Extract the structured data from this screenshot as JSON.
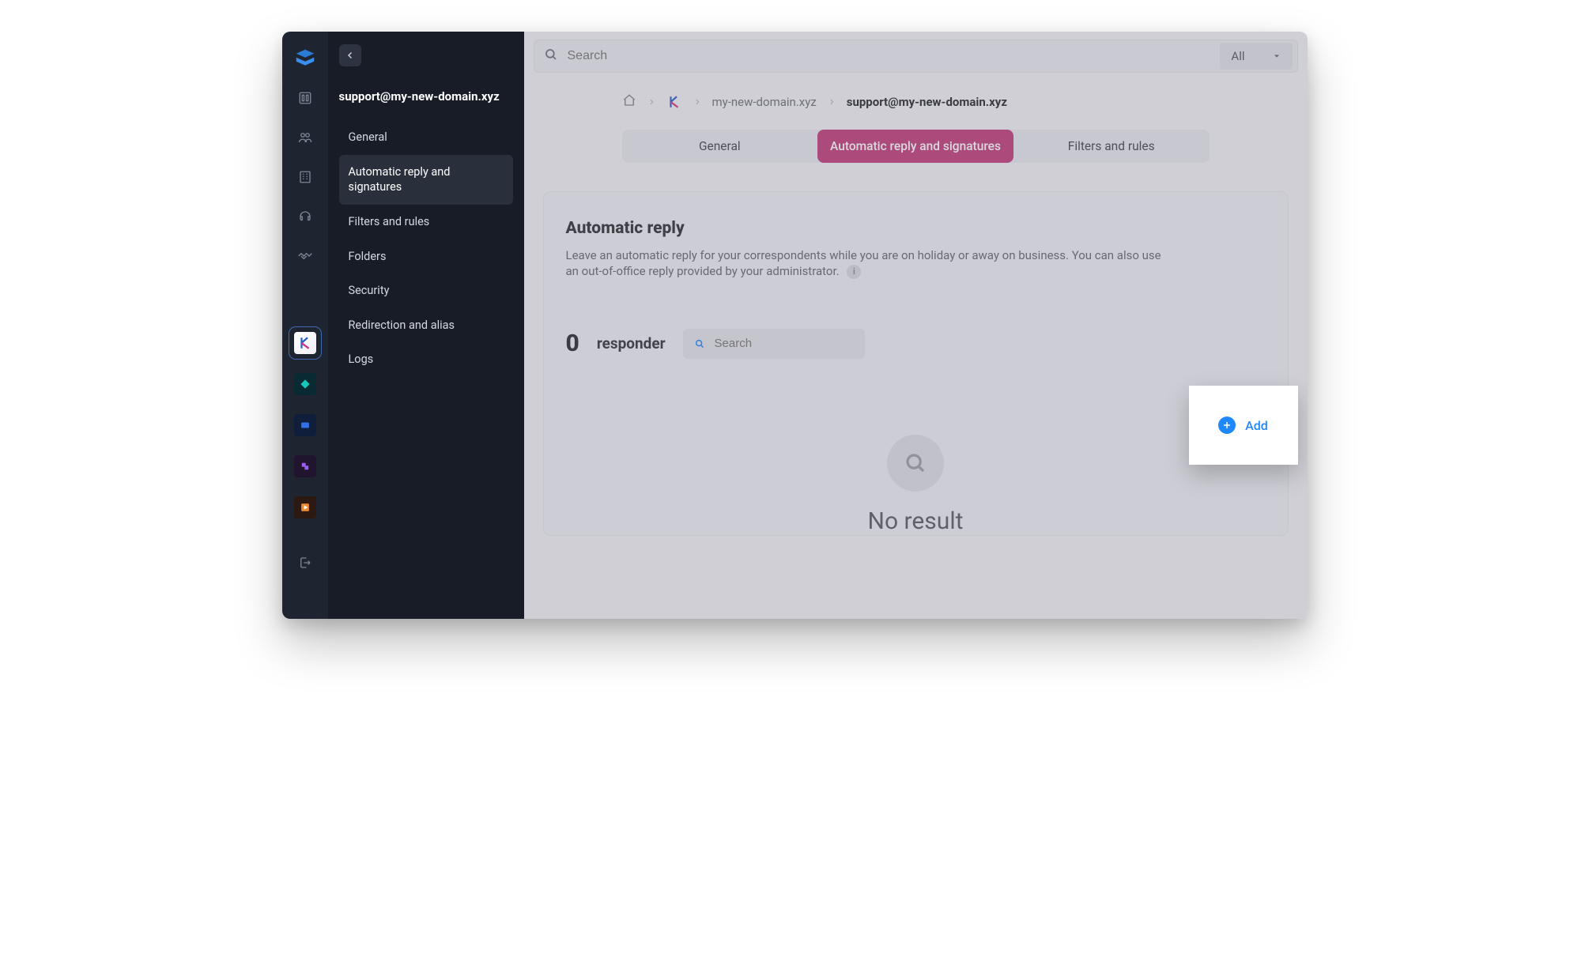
{
  "sidebar": {
    "title": "support@my-new-domain.xyz",
    "items": [
      {
        "label": "General"
      },
      {
        "label": "Automatic reply and signatures"
      },
      {
        "label": "Filters and rules"
      },
      {
        "label": "Folders"
      },
      {
        "label": "Security"
      },
      {
        "label": "Redirection and alias"
      },
      {
        "label": "Logs"
      }
    ]
  },
  "topbar": {
    "search_placeholder": "Search",
    "filter_label": "All"
  },
  "breadcrumb": {
    "domain": "my-new-domain.xyz",
    "current": "support@my-new-domain.xyz"
  },
  "tabs": [
    {
      "label": "General"
    },
    {
      "label": "Automatic reply and signatures"
    },
    {
      "label": "Filters and rules"
    }
  ],
  "panel": {
    "heading": "Automatic reply",
    "description": "Leave an automatic reply for your correspondents while you are on holiday or away on business. You can also use an out-of-office reply provided by your administrator.",
    "info_glyph": "i",
    "responder_count": "0",
    "responder_label": "responder",
    "responder_search_placeholder": "Search",
    "empty_text": "No result"
  },
  "add_button": {
    "label": "Add"
  }
}
